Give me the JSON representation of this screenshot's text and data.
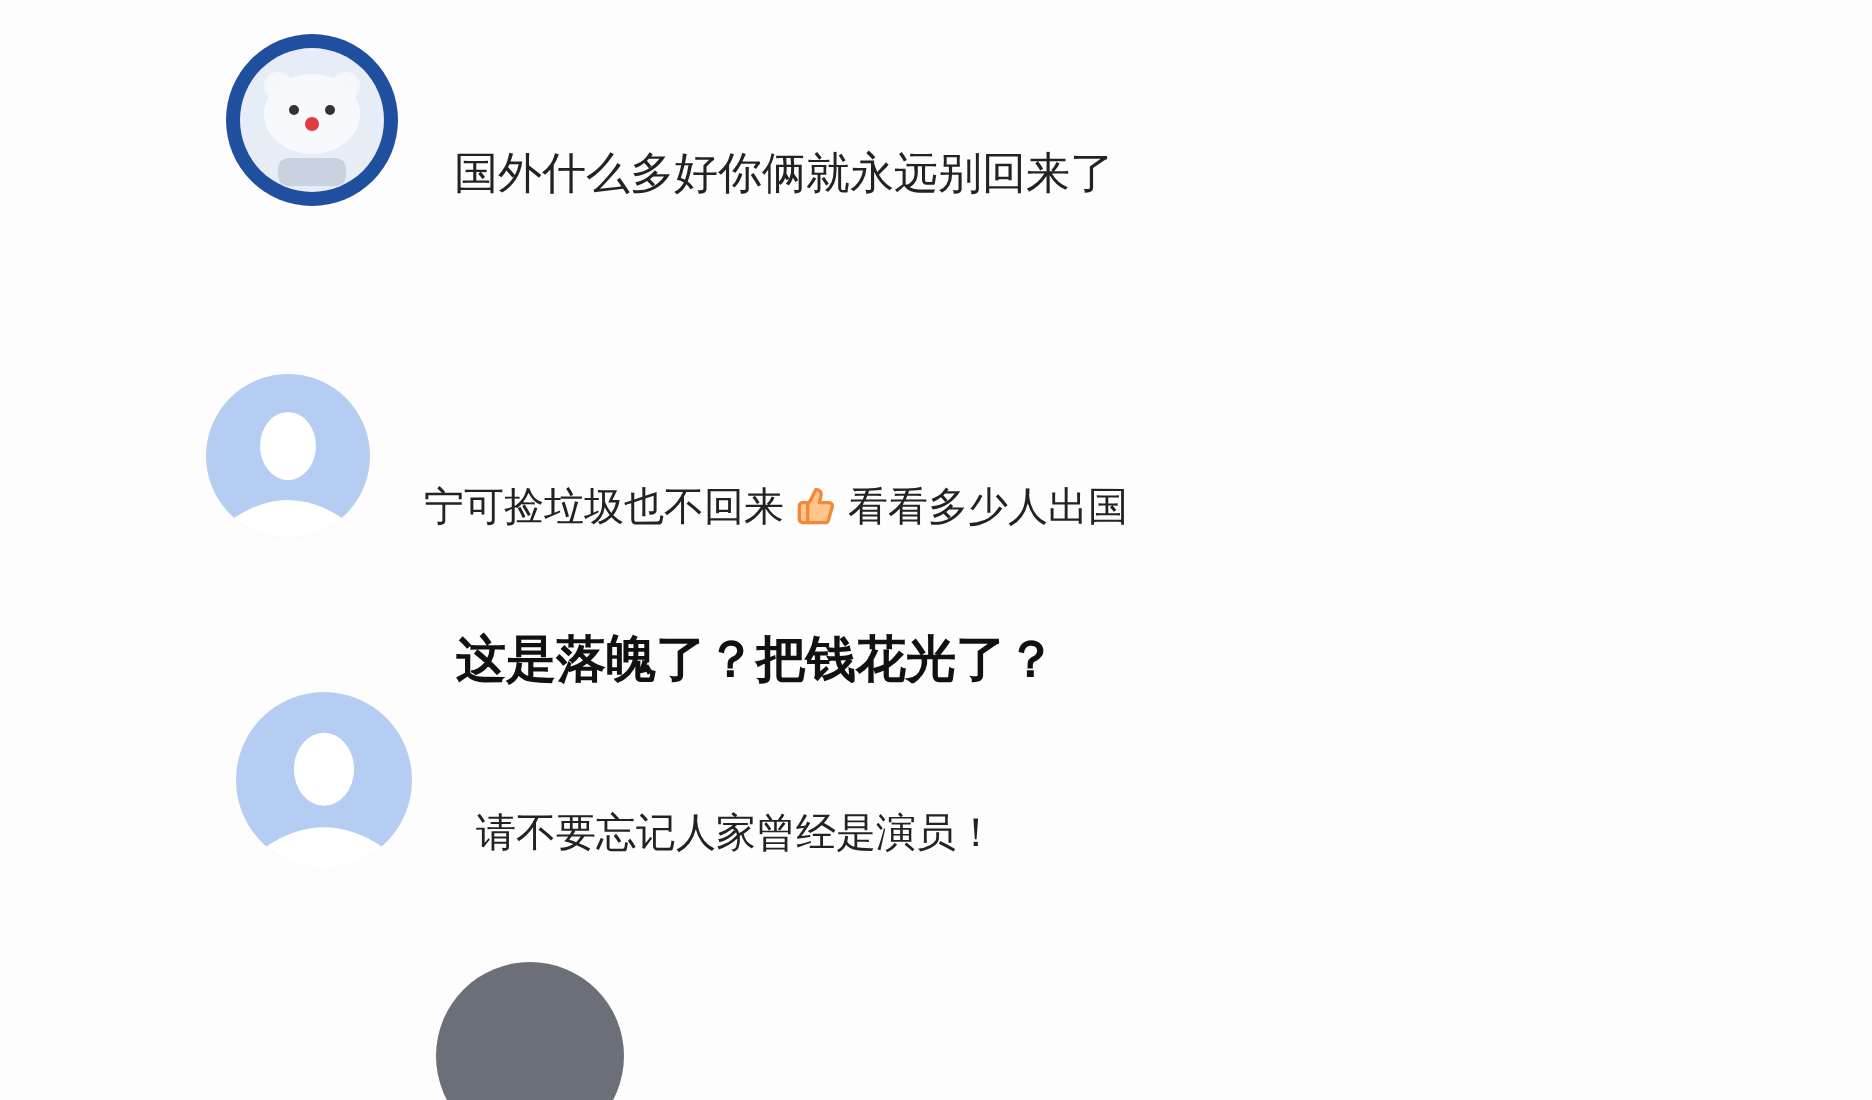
{
  "comments": [
    {
      "kind": "comment",
      "avatar": {
        "kind": "bear"
      },
      "text": "国外什么多好你俩就永远别回来了"
    },
    {
      "kind": "comment",
      "avatar": {
        "kind": "default"
      },
      "text": "宁可捡垃圾也不回来",
      "emoji": {
        "kind": "thumbs"
      },
      "text_after": "看看多少人出国"
    },
    {
      "kind": "caption",
      "text": "这是落魄了？把钱花光了？"
    },
    {
      "kind": "comment",
      "avatar": {
        "kind": "default"
      },
      "text": "请不要忘记人家曾经是演员！"
    },
    {
      "kind": "comment",
      "avatar": {
        "kind": "photo"
      }
    }
  ]
}
